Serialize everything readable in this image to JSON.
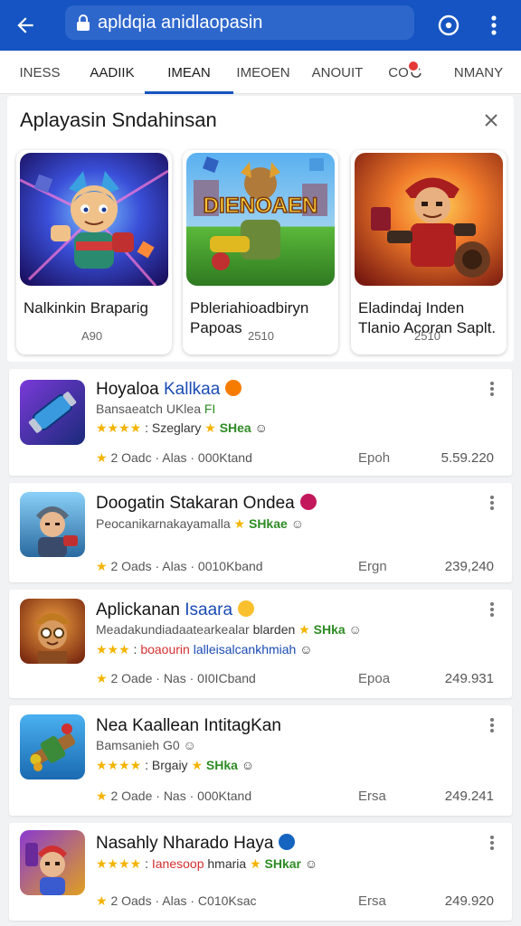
{
  "topbar": {
    "url": "apldqia anidlaopasin",
    "icons": [
      "back-arrow-icon",
      "lock-icon",
      "compass-icon",
      "more-vert-icon"
    ],
    "color": "#1554c2"
  },
  "tabs": [
    {
      "label": "INESS"
    },
    {
      "label": "AADIIK"
    },
    {
      "label": "IMEAN",
      "active": true
    },
    {
      "label": "IMEOEN"
    },
    {
      "label": "ANOUIT"
    },
    {
      "label": "CO"
    },
    {
      "label": "NMANY"
    }
  ],
  "recommendations": {
    "title": "Aplayasin Sndahinsan",
    "items": [
      {
        "name": "Nalkinkin Braparig",
        "price": "A90"
      },
      {
        "name": "Pbleriahioadbiryn Papoas",
        "price": "2510"
      },
      {
        "name": "Eladindaj Inden Tlanio Acoran Saplt.",
        "price": "2510"
      }
    ],
    "banner_text": "DIENOAEN"
  },
  "apps": [
    {
      "title": "Hoyaloa",
      "title_accent": "Kallkaa",
      "line2": "Bansaeatch",
      "line2b": "UKlea",
      "line2c": "FI",
      "rating_text": "Szeglary",
      "rating_tag": "SHea",
      "meta": "2 Oadc · Alas · 000Ktand",
      "mid": "Epoh",
      "num": "5.59.220",
      "badge_color": "#f57c00",
      "num_color": "#d32f2f"
    },
    {
      "title": "Doogatin Stakaran Ondea",
      "line2": "Peocanikarnakayamalla",
      "line2_tag": "SHkae",
      "meta": "2 Oads · Alas · 0010Kband",
      "mid": "Ergn",
      "num": "239,240",
      "badge_color": "#c2185b"
    },
    {
      "title": "Aplickanan",
      "title_accent": "Isaara",
      "line2": "Meadakundiadaatearkealar",
      "line2b": "blarden",
      "line2_tag": "SHka",
      "line3": "boaourin",
      "line3b": "lalleisalcankhmiah",
      "meta": "2 Oade · Nas · 0I0ICband",
      "mid": "Epoa",
      "num": "249.931",
      "badge_color": "#fbc02d"
    },
    {
      "title": "Nea Kaallean IntitagKan",
      "line2": "Bamsanieh",
      "line2b": "G0",
      "rating_text": "Brgaiy",
      "rating_tag": "SHka",
      "meta": "2 Oade · Nas · 000Ktand",
      "mid": "Ersa",
      "num": "249.241"
    },
    {
      "title": "Nasahly Nharado Haya",
      "rating_text": "Ianesoop",
      "rating_text2": "hmaria",
      "rating_tag": "SHkar",
      "meta": "2 Oads · Alas · C010Ksac",
      "mid": "Ersa",
      "num": "249.920",
      "badge_color": "#1565c0"
    }
  ]
}
